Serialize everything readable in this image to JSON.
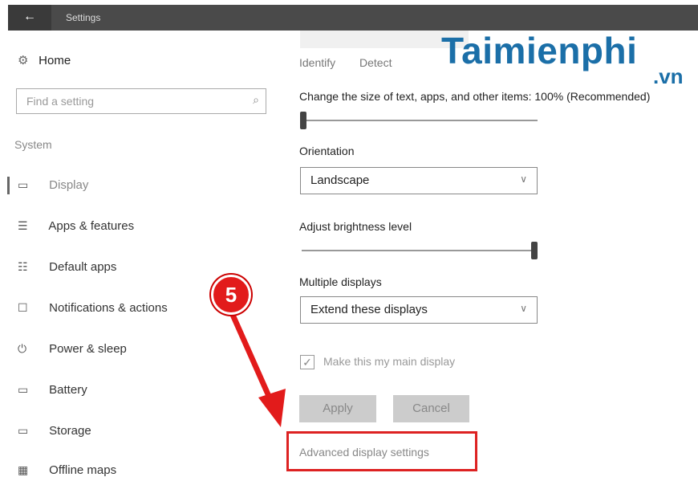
{
  "window": {
    "title": "Settings",
    "back_glyph": "←"
  },
  "sidebar": {
    "home": {
      "icon": "gear-icon",
      "glyph": "⚙",
      "label": "Home"
    },
    "search_placeholder": "Find a setting",
    "section_label": "System",
    "items": [
      {
        "icon": "monitor-icon",
        "glyph": "▭",
        "label": "Display",
        "active": true
      },
      {
        "icon": "apps-list-icon",
        "glyph": "☰",
        "label": "Apps & features"
      },
      {
        "icon": "default-apps-icon",
        "glyph": "☷",
        "label": "Default apps"
      },
      {
        "icon": "notification-icon",
        "glyph": "☐",
        "label": "Notifications & actions"
      },
      {
        "icon": "power-icon",
        "glyph": "⏻",
        "label": "Power & sleep"
      },
      {
        "icon": "battery-icon",
        "glyph": "▭",
        "label": "Battery"
      },
      {
        "icon": "storage-icon",
        "glyph": "▭",
        "label": "Storage"
      },
      {
        "icon": "map-icon",
        "glyph": "▦",
        "label": "Offline maps"
      }
    ]
  },
  "main": {
    "identify_label": "Identify",
    "detect_label": "Detect",
    "scale_label": "Change the size of text, apps, and other items: 100% (Recommended)",
    "scale_level": 0,
    "orientation_label": "Orientation",
    "orientation_value": "Landscape",
    "brightness_label": "Adjust brightness level",
    "brightness_level": 1.0,
    "multiple_displays_label": "Multiple displays",
    "multiple_displays_value": "Extend these displays",
    "main_display_label": "Make this my main display",
    "main_display_checked": true,
    "apply_label": "Apply",
    "cancel_label": "Cancel",
    "advanced_link": "Advanced display settings"
  },
  "annotation": {
    "step_number": "5",
    "highlight_color": "#dd2222"
  },
  "watermark": {
    "brand": "Taimienphi",
    "suffix": ".vn",
    "color": "#1b6fa8"
  }
}
